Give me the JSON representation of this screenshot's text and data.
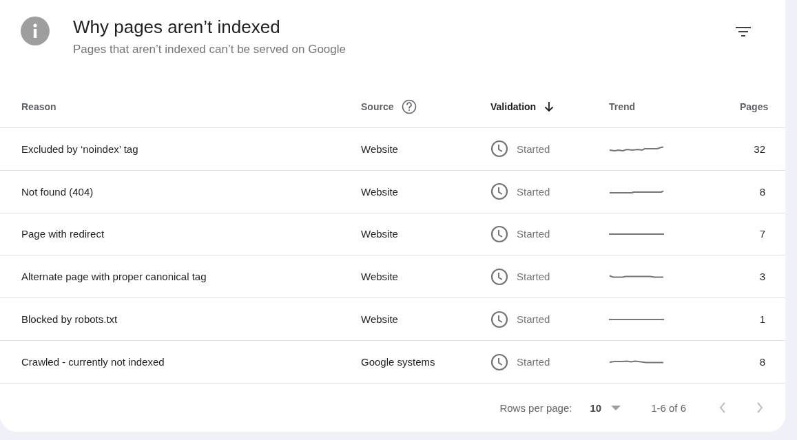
{
  "header": {
    "title": "Why pages aren’t indexed",
    "subtitle": "Pages that aren’t indexed can’t be served on Google"
  },
  "table": {
    "columns": [
      {
        "label": "Reason",
        "sorted": false,
        "help": false
      },
      {
        "label": "Source",
        "sorted": false,
        "help": true
      },
      {
        "label": "Validation",
        "sorted": true,
        "help": false
      },
      {
        "label": "Trend",
        "sorted": false,
        "help": false
      },
      {
        "label": "Pages",
        "sorted": false,
        "help": false
      }
    ],
    "rows": [
      {
        "reason": "Excluded by ‘noindex’ tag",
        "source": "Website",
        "validation": "Started",
        "pages": "32"
      },
      {
        "reason": "Not found (404)",
        "source": "Website",
        "validation": "Started",
        "pages": "8"
      },
      {
        "reason": "Page with redirect",
        "source": "Website",
        "validation": "Started",
        "pages": "7"
      },
      {
        "reason": "Alternate page with proper canonical tag",
        "source": "Website",
        "validation": "Started",
        "pages": "3"
      },
      {
        "reason": "Blocked by robots.txt",
        "source": "Website",
        "validation": "Started",
        "pages": "1"
      },
      {
        "reason": "Crawled - currently not indexed",
        "source": "Google systems",
        "validation": "Started",
        "pages": "8"
      }
    ]
  },
  "pagination": {
    "rows_per_page_label": "Rows per page:",
    "rows_per_page": "10",
    "range": "1-6 of 6",
    "prev_disabled": true,
    "next_disabled": true
  }
}
